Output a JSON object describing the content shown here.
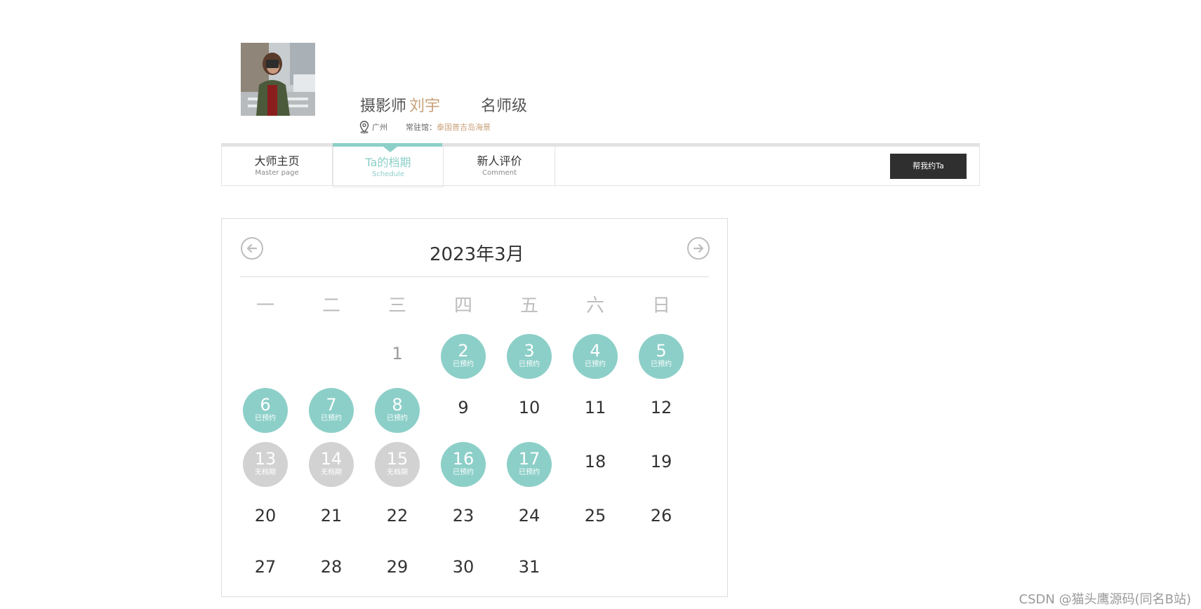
{
  "profile": {
    "role": "摄影师",
    "name": "刘宇",
    "level": "名师级",
    "city": "广州",
    "resident_label": "常驻馆：",
    "resident_value": "泰国普吉岛海景"
  },
  "tabs": [
    {
      "label": "大师主页",
      "sub": "Master page",
      "active": false
    },
    {
      "label": "Ta的档期",
      "sub": "Schedule",
      "active": true
    },
    {
      "label": "新人评价",
      "sub": "Comment",
      "active": false
    }
  ],
  "book_button": "帮我约Ta",
  "calendar": {
    "title": "2023年3月",
    "weekdays": [
      "一",
      "二",
      "三",
      "四",
      "五",
      "六",
      "日"
    ],
    "booked_label": "已预约",
    "nosched_label": "无档期",
    "days": [
      {
        "d": "1",
        "state": "past"
      },
      {
        "d": "2",
        "state": "booked"
      },
      {
        "d": "3",
        "state": "booked"
      },
      {
        "d": "4",
        "state": "booked"
      },
      {
        "d": "5",
        "state": "booked"
      },
      {
        "d": "6",
        "state": "booked"
      },
      {
        "d": "7",
        "state": "booked"
      },
      {
        "d": "8",
        "state": "booked"
      },
      {
        "d": "9",
        "state": "free"
      },
      {
        "d": "10",
        "state": "free"
      },
      {
        "d": "11",
        "state": "free"
      },
      {
        "d": "12",
        "state": "free"
      },
      {
        "d": "13",
        "state": "nosched"
      },
      {
        "d": "14",
        "state": "nosched"
      },
      {
        "d": "15",
        "state": "nosched"
      },
      {
        "d": "16",
        "state": "booked"
      },
      {
        "d": "17",
        "state": "booked"
      },
      {
        "d": "18",
        "state": "free"
      },
      {
        "d": "19",
        "state": "free"
      },
      {
        "d": "20",
        "state": "free"
      },
      {
        "d": "21",
        "state": "free"
      },
      {
        "d": "22",
        "state": "free"
      },
      {
        "d": "23",
        "state": "free"
      },
      {
        "d": "24",
        "state": "free"
      },
      {
        "d": "25",
        "state": "free"
      },
      {
        "d": "26",
        "state": "free"
      },
      {
        "d": "27",
        "state": "free"
      },
      {
        "d": "28",
        "state": "free"
      },
      {
        "d": "29",
        "state": "free"
      },
      {
        "d": "30",
        "state": "free"
      },
      {
        "d": "31",
        "state": "free"
      }
    ]
  },
  "watermark": "CSDN @猫头鹰源码(同名B站)",
  "icons": {
    "prev": "arrow-left-circle-icon",
    "next": "arrow-right-circle-icon",
    "location": "location-pin-icon"
  },
  "colors": {
    "accent": "#8ccfc8",
    "gold": "#c9a27a",
    "nosched": "#d2d2d2",
    "button": "#2f2f2f"
  }
}
